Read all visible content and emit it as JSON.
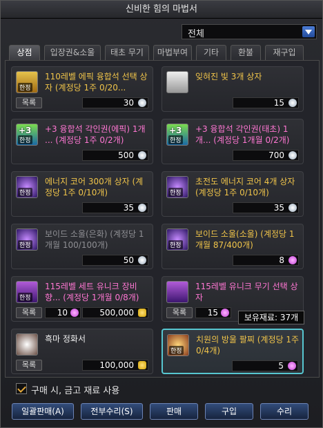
{
  "window": {
    "title": "신비한 힘의 마법서"
  },
  "filter": {
    "value": "전체"
  },
  "tabs": [
    {
      "label": "상점"
    },
    {
      "label": "입장권&소울"
    },
    {
      "label": "태초 무기"
    },
    {
      "label": "마법부여"
    },
    {
      "label": "기타"
    },
    {
      "label": "환불"
    },
    {
      "label": "재구입"
    }
  ],
  "items": [
    {
      "name": "110레벨 에픽 융합석 선택 상자 (계정당 1주 0/20...",
      "badge": "목록",
      "price": "30",
      "currency": "silver",
      "tag": "한정",
      "color": "yellow"
    },
    {
      "name": "잊혀진 빛 3개 상자",
      "badge": "",
      "price": "15",
      "currency": "silver",
      "tag": "",
      "color": "yellow"
    },
    {
      "name": "+3 융합석 각인권(에픽) 1개 ... (계정당 1주 0/2개)",
      "badge": "",
      "price": "500",
      "currency": "silver",
      "tag": "한정",
      "color": "pink"
    },
    {
      "name": "+3 융합석 각인권(태초) 1개... (계정당 1개월 0/2개)",
      "badge": "",
      "price": "700",
      "currency": "silver",
      "tag": "한정",
      "color": "pink"
    },
    {
      "name": "에너지 코어 300개 상자 (계정당 1주 0/10개)",
      "badge": "",
      "price": "35",
      "currency": "silver",
      "tag": "한정",
      "color": "yellow"
    },
    {
      "name": "초전도 에너지 코어 4개 상자 (계정당 1주 0/10개)",
      "badge": "",
      "price": "35",
      "currency": "silver",
      "tag": "한정",
      "color": "yellow"
    },
    {
      "name": "보이드 소울(은화) (계정당 1개월 100/100개)",
      "badge": "",
      "price": "50",
      "currency": "silver",
      "tag": "한정",
      "color": "gray"
    },
    {
      "name": "보이드 소울(소울) (계정당 1개월 87/400개)",
      "badge": "",
      "price": "8",
      "currency": "pink",
      "tag": "한정",
      "color": "yellow"
    },
    {
      "name": "115레벨 세트 유니크 장비 향... (계정당 1개월 0/8개)",
      "badge": "목록",
      "price": "500,000",
      "currency": "gold",
      "extra": "10",
      "tag": "한정",
      "color": "pink"
    },
    {
      "name": "115레벨 유니크 무기 선택 상자",
      "badge": "목록",
      "price": "",
      "currency": "",
      "extra": "15",
      "tag": "",
      "color": "pink"
    },
    {
      "name": "흑마 정화서",
      "badge": "목록",
      "price": "100,000",
      "currency": "gold",
      "tag": "",
      "color": "white"
    },
    {
      "name": "치원의 방울 팔찌 (계정당 1주 0/4개)",
      "badge": "",
      "price": "5",
      "currency": "pink",
      "tag": "한정",
      "color": "yellow",
      "selected": true
    }
  ],
  "tooltip": {
    "text": "보유재료: 37개"
  },
  "option": {
    "label": "구매 시, 금고 재료 사용",
    "checked": true
  },
  "buttons": [
    {
      "label": "일괄판매(A)"
    },
    {
      "label": "전부수리(S)"
    },
    {
      "label": "판매"
    },
    {
      "label": "구입"
    },
    {
      "label": "수리"
    }
  ],
  "colors": {
    "accent": "#57c7d1",
    "yellow": "#f0c44a",
    "pink": "#ff77d3",
    "gray": "#8f8f94"
  }
}
